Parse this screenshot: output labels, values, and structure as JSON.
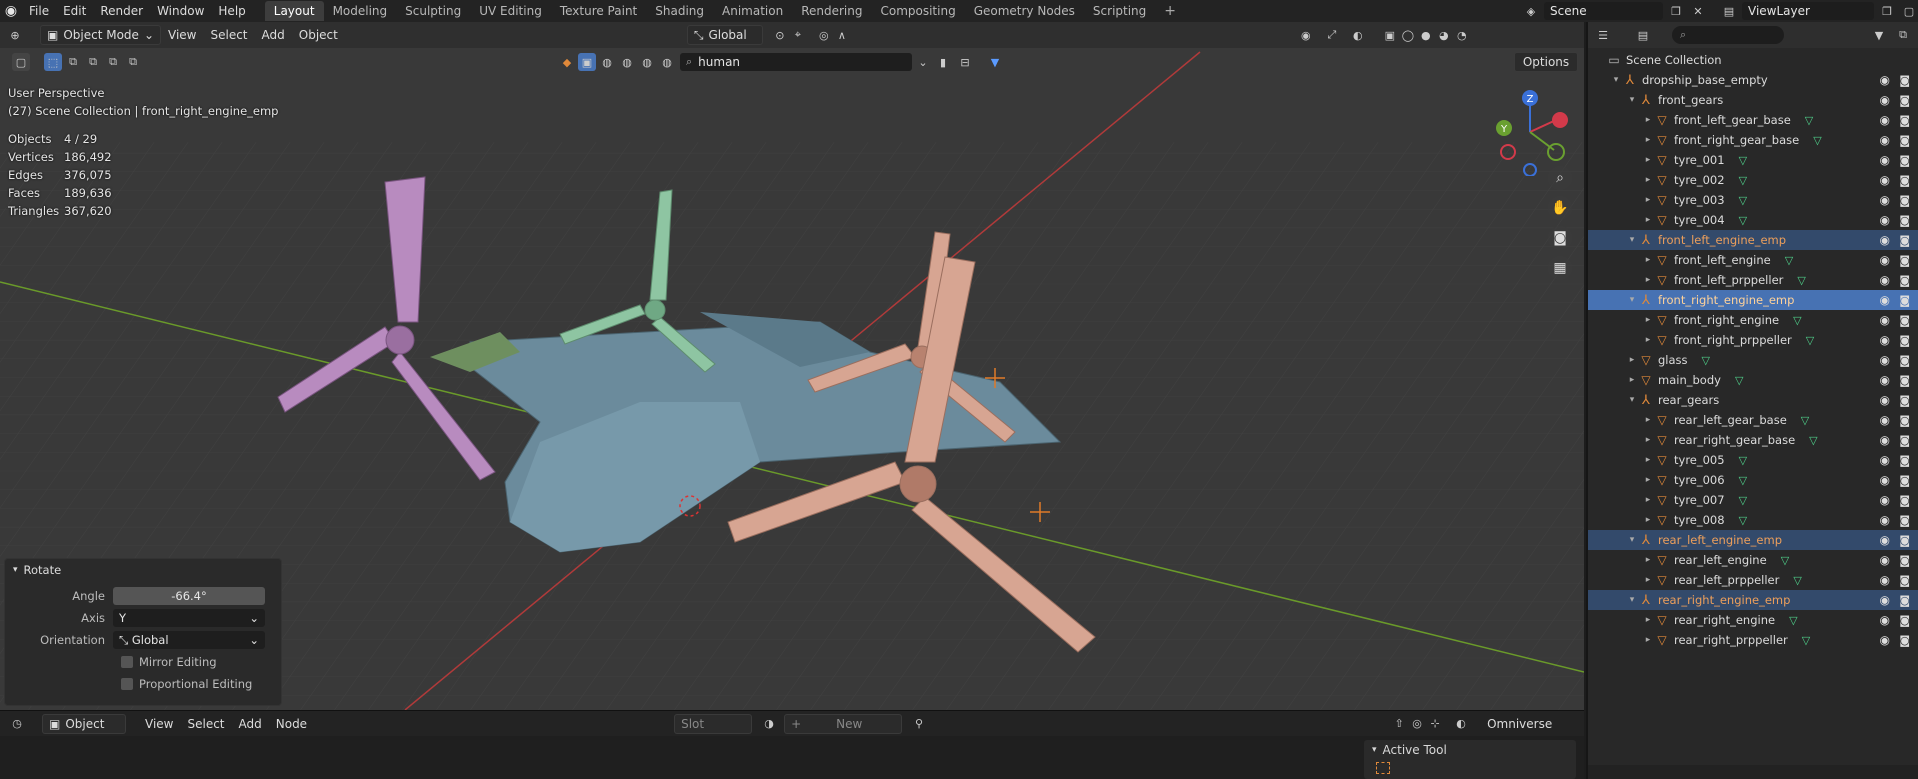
{
  "topbar": {
    "menus": [
      "File",
      "Edit",
      "Render",
      "Window",
      "Help"
    ],
    "workspaces": [
      "Layout",
      "Modeling",
      "Sculpting",
      "UV Editing",
      "Texture Paint",
      "Shading",
      "Animation",
      "Rendering",
      "Compositing",
      "Geometry Nodes",
      "Scripting"
    ],
    "add_tab": "+",
    "scene": "Scene",
    "view_layer": "ViewLayer"
  },
  "viewport": {
    "mode": "Object Mode",
    "menus": [
      "View",
      "Select",
      "Add",
      "Object"
    ],
    "transform_orientation": "Global",
    "filter_search": "human",
    "options_label": "Options",
    "perspective": "User Perspective",
    "context": "(27) Scene Collection | front_right_engine_emp",
    "stats": [
      {
        "label": "Objects",
        "value": "4 / 29"
      },
      {
        "label": "Vertices",
        "value": "186,492"
      },
      {
        "label": "Edges",
        "value": "376,075"
      },
      {
        "label": "Faces",
        "value": "189,636"
      },
      {
        "label": "Triangles",
        "value": "367,620"
      }
    ],
    "gizmo": {
      "x": "",
      "y": "Y",
      "z": "Z"
    }
  },
  "rotate_panel": {
    "title": "Rotate",
    "angle_label": "Angle",
    "angle_value": "-66.4°",
    "axis_label": "Axis",
    "axis_value": "Y",
    "orientation_label": "Orientation",
    "orientation_value": "Global",
    "mirror_label": "Mirror Editing",
    "proportional_label": "Proportional Editing"
  },
  "shader_header": {
    "object_dd": "Object",
    "menus": [
      "View",
      "Select",
      "Add",
      "Node"
    ],
    "slot": "Slot",
    "new_label": "New",
    "renderer": "Omniverse",
    "active_tool": "Active Tool"
  },
  "outliner": {
    "search_placeholder": "",
    "rows": [
      {
        "name": "Scene Collection",
        "indent": 0,
        "type": "coll",
        "arrow": "",
        "data": false,
        "vis": false
      },
      {
        "name": "dropship_base_empty",
        "indent": 1,
        "type": "empty",
        "arrow": "▾",
        "data": false,
        "vis": true
      },
      {
        "name": "front_gears",
        "indent": 2,
        "type": "empty",
        "arrow": "▾",
        "data": false,
        "vis": true
      },
      {
        "name": "front_left_gear_base",
        "indent": 3,
        "type": "mesh",
        "arrow": "▸",
        "data": true,
        "vis": true
      },
      {
        "name": "front_right_gear_base",
        "indent": 3,
        "type": "mesh",
        "arrow": "▸",
        "data": true,
        "vis": true
      },
      {
        "name": "tyre_001",
        "indent": 3,
        "type": "mesh",
        "arrow": "▸",
        "data": true,
        "vis": true
      },
      {
        "name": "tyre_002",
        "indent": 3,
        "type": "mesh",
        "arrow": "▸",
        "data": true,
        "vis": true
      },
      {
        "name": "tyre_003",
        "indent": 3,
        "type": "mesh",
        "arrow": "▸",
        "data": true,
        "vis": true
      },
      {
        "name": "tyre_004",
        "indent": 3,
        "type": "mesh",
        "arrow": "▸",
        "data": true,
        "vis": true
      },
      {
        "name": "front_left_engine_emp",
        "indent": 2,
        "type": "empty",
        "arrow": "▾",
        "data": false,
        "vis": true,
        "state": "sel"
      },
      {
        "name": "front_left_engine",
        "indent": 3,
        "type": "mesh",
        "arrow": "▸",
        "data": true,
        "vis": true
      },
      {
        "name": "front_left_prppeller",
        "indent": 3,
        "type": "mesh",
        "arrow": "▸",
        "data": true,
        "vis": true
      },
      {
        "name": "front_right_engine_emp",
        "indent": 2,
        "type": "empty",
        "arrow": "▾",
        "data": false,
        "vis": true,
        "state": "act"
      },
      {
        "name": "front_right_engine",
        "indent": 3,
        "type": "mesh",
        "arrow": "▸",
        "data": true,
        "vis": true
      },
      {
        "name": "front_right_prppeller",
        "indent": 3,
        "type": "mesh",
        "arrow": "▸",
        "data": true,
        "vis": true
      },
      {
        "name": "glass",
        "indent": 2,
        "type": "mesh",
        "arrow": "▸",
        "data": true,
        "vis": true
      },
      {
        "name": "main_body",
        "indent": 2,
        "type": "mesh",
        "arrow": "▸",
        "data": true,
        "vis": true
      },
      {
        "name": "rear_gears",
        "indent": 2,
        "type": "empty",
        "arrow": "▾",
        "data": false,
        "vis": true
      },
      {
        "name": "rear_left_gear_base",
        "indent": 3,
        "type": "mesh",
        "arrow": "▸",
        "data": true,
        "vis": true
      },
      {
        "name": "rear_right_gear_base",
        "indent": 3,
        "type": "mesh",
        "arrow": "▸",
        "data": true,
        "vis": true
      },
      {
        "name": "tyre_005",
        "indent": 3,
        "type": "mesh",
        "arrow": "▸",
        "data": true,
        "vis": true
      },
      {
        "name": "tyre_006",
        "indent": 3,
        "type": "mesh",
        "arrow": "▸",
        "data": true,
        "vis": true
      },
      {
        "name": "tyre_007",
        "indent": 3,
        "type": "mesh",
        "arrow": "▸",
        "data": true,
        "vis": true
      },
      {
        "name": "tyre_008",
        "indent": 3,
        "type": "mesh",
        "arrow": "▸",
        "data": true,
        "vis": true
      },
      {
        "name": "rear_left_engine_emp",
        "indent": 2,
        "type": "empty",
        "arrow": "▾",
        "data": false,
        "vis": true,
        "state": "sel"
      },
      {
        "name": "rear_left_engine",
        "indent": 3,
        "type": "mesh",
        "arrow": "▸",
        "data": true,
        "vis": true
      },
      {
        "name": "rear_left_prppeller",
        "indent": 3,
        "type": "mesh",
        "arrow": "▸",
        "data": true,
        "vis": true
      },
      {
        "name": "rear_right_engine_emp",
        "indent": 2,
        "type": "empty",
        "arrow": "▾",
        "data": false,
        "vis": true,
        "state": "sel"
      },
      {
        "name": "rear_right_engine",
        "indent": 3,
        "type": "mesh",
        "arrow": "▸",
        "data": true,
        "vis": true
      },
      {
        "name": "rear_right_prppeller",
        "indent": 3,
        "type": "mesh",
        "arrow": "▸",
        "data": true,
        "vis": true
      }
    ]
  },
  "colors": {
    "accent_selected": "#4772b3",
    "selected_row": "#334a6b",
    "object_orange": "#e0893a",
    "mesh_data_green": "#4fd08a"
  }
}
